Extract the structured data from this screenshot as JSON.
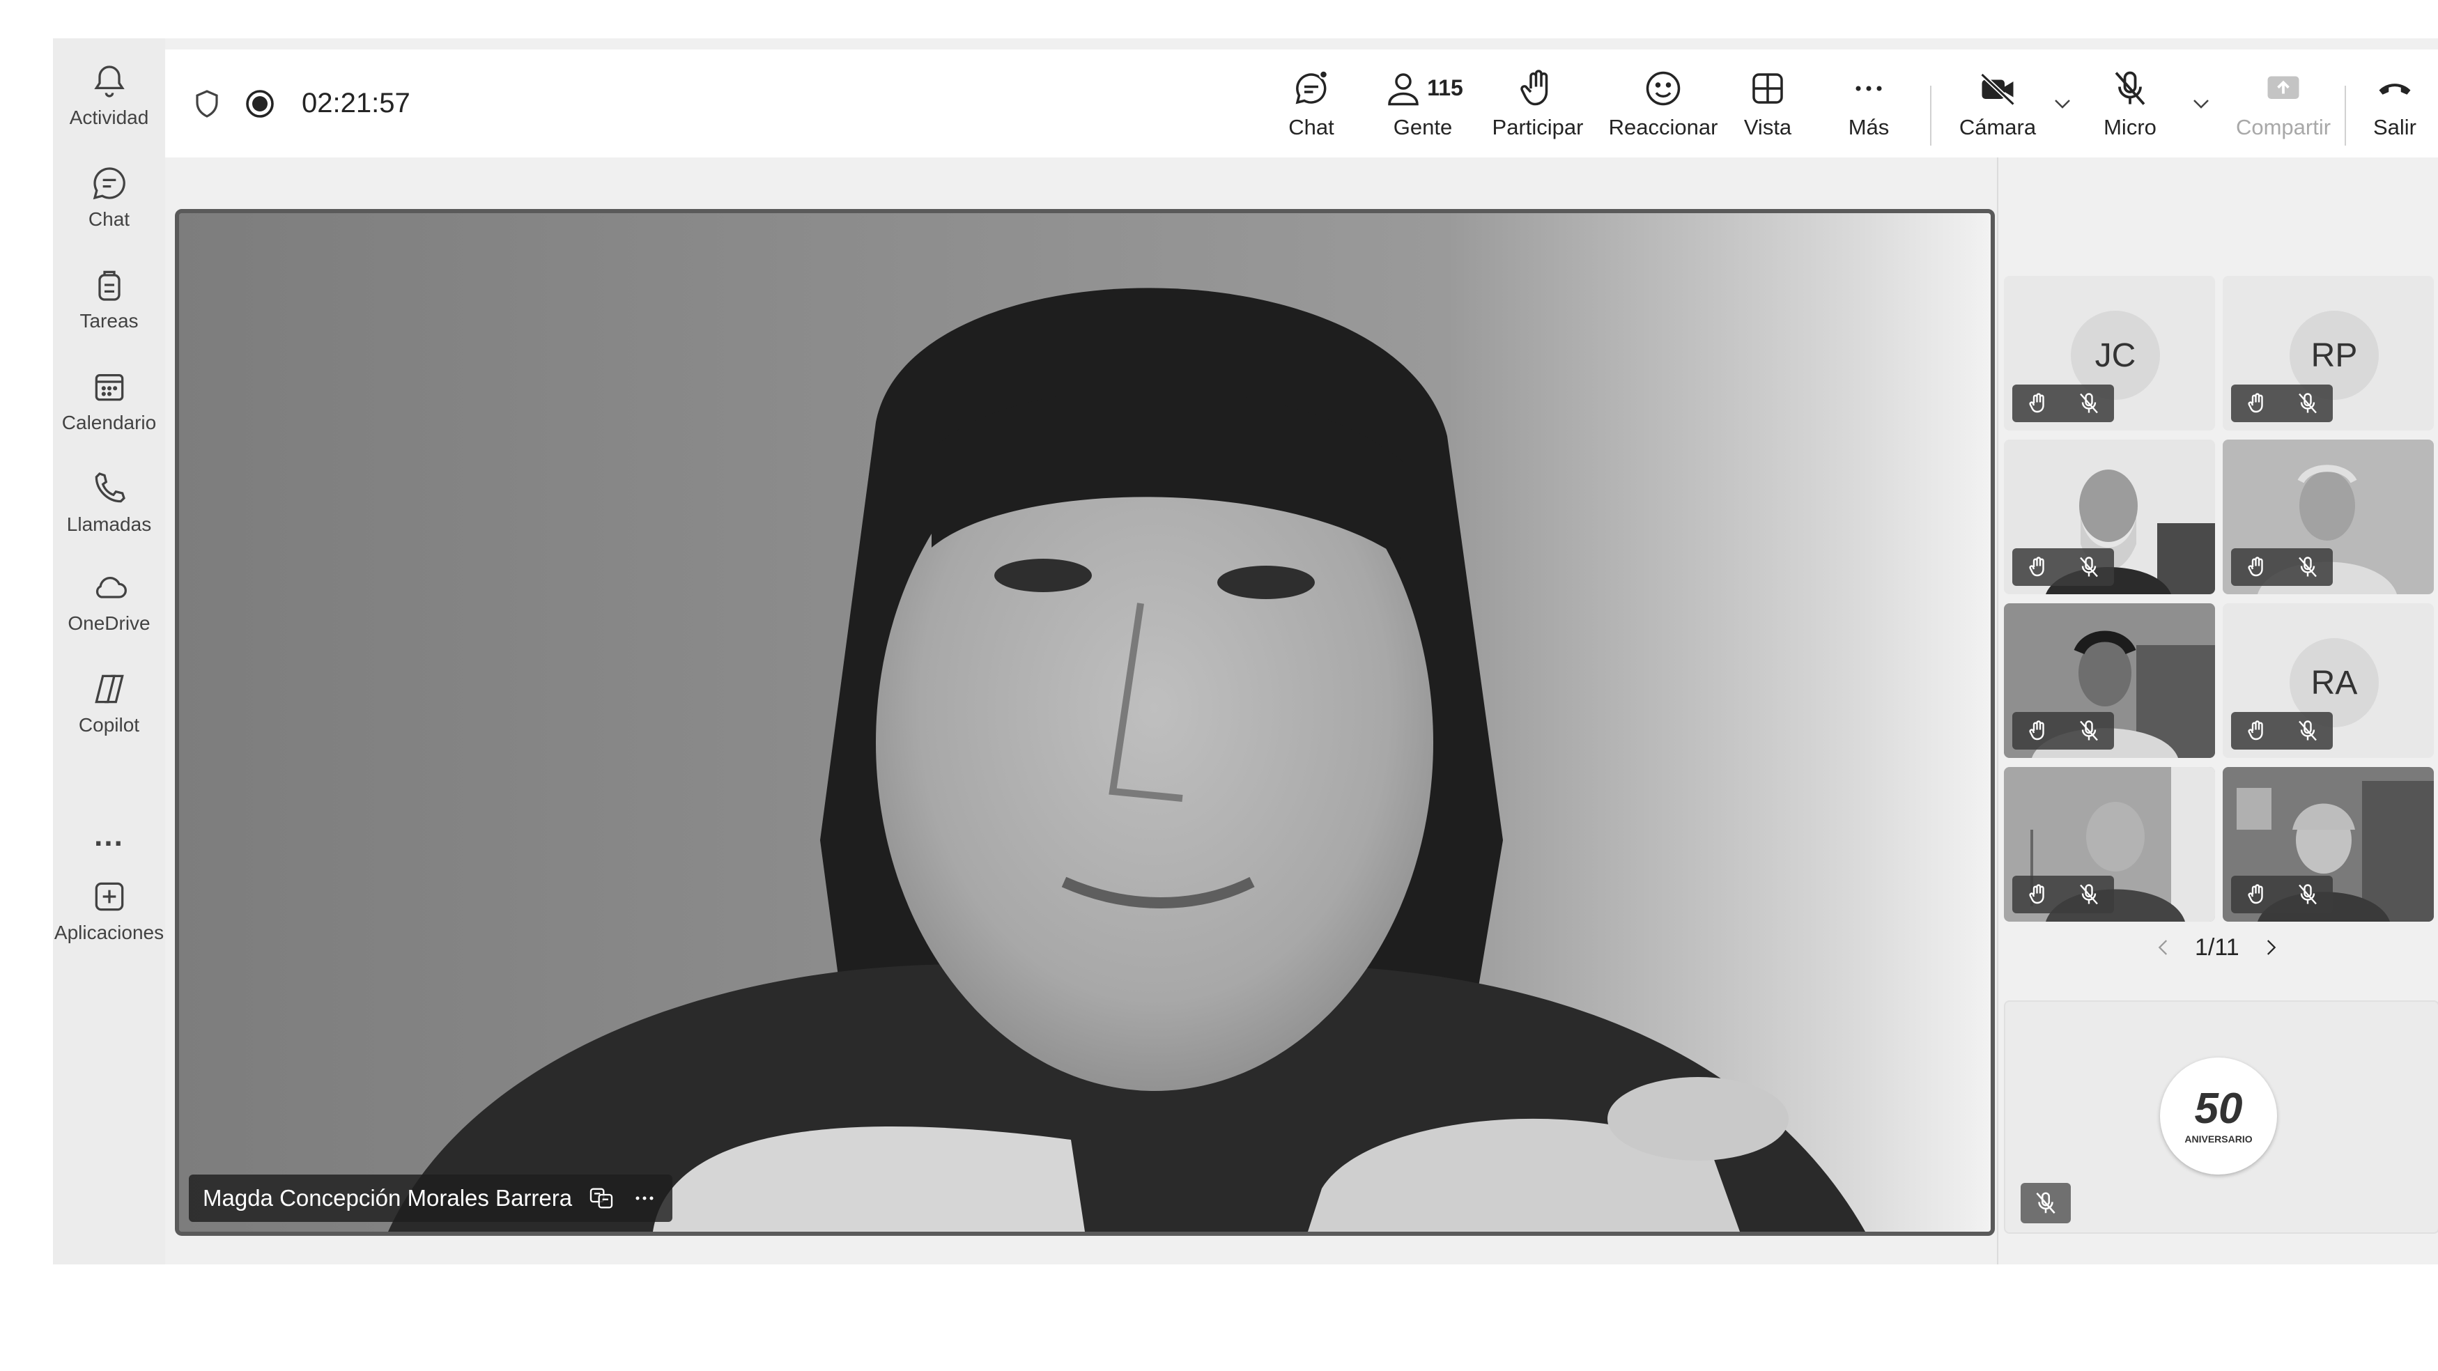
{
  "rail": {
    "items": [
      {
        "label": "Actividad",
        "icon": "bell-icon"
      },
      {
        "label": "Chat",
        "icon": "chat-icon"
      },
      {
        "label": "Tareas",
        "icon": "tasks-icon"
      },
      {
        "label": "Calendario",
        "icon": "calendar-icon"
      },
      {
        "label": "Llamadas",
        "icon": "phone-icon"
      },
      {
        "label": "OneDrive",
        "icon": "cloud-icon"
      },
      {
        "label": "Copilot",
        "icon": "copilot-icon"
      },
      {
        "label": "...",
        "icon": "more-icon"
      },
      {
        "label": "Aplicaciones",
        "icon": "add-apps-icon"
      }
    ]
  },
  "toolbar": {
    "timer": "02:21:57",
    "chat_label": "Chat",
    "people_label": "Gente",
    "people_count": "115",
    "raise_label": "Participar",
    "react_label": "Reaccionar",
    "view_label": "Vista",
    "more_label": "Más",
    "camera_label": "Cámara",
    "mic_label": "Micro",
    "share_label": "Compartir",
    "leave_label": "Salir"
  },
  "stage": {
    "speaker_name": "Magda Concepción Morales Barrera"
  },
  "panel": {
    "tiles": [
      {
        "initials": "JC"
      },
      {
        "initials": "RP"
      },
      {
        "initials": ""
      },
      {
        "initials": ""
      },
      {
        "initials": ""
      },
      {
        "initials": "RA"
      },
      {
        "initials": ""
      },
      {
        "initials": ""
      }
    ],
    "page": "1/11",
    "logo_number": "50",
    "logo_text": "ANIVERSARIO"
  },
  "colors": {
    "rail_bg": "#ececec",
    "toolbar_bg": "#ffffff",
    "app_bg": "#f0f0f0",
    "stage_border": "#5a5a5a"
  }
}
